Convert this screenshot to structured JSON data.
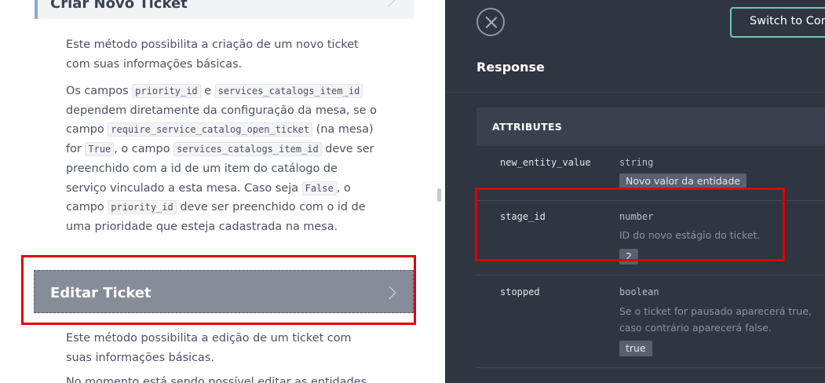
{
  "left": {
    "prev_section": {
      "title": "Criar Novo Ticket"
    },
    "intro_text": "Este método possibilita a criação de um novo ticket com suas informações básicas.",
    "para2": {
      "t1": "Os campos ",
      "c1": "priority_id",
      "t2": " e ",
      "c2": "services_catalogs_item_id",
      "t3": " dependem diretamente da configuração da mesa, se o campo ",
      "c3": "require_service_catalog_open_ticket",
      "t4": " (na mesa) for ",
      "c4": "True",
      "t5": ", o campo ",
      "c5": "services_catalogs_item_id",
      "t6": " deve ser preenchido com a id de um item do catálogo de serviço vinculado a esta mesa. Caso seja ",
      "c6": "False",
      "t7": ", o campo ",
      "c7": "priority_id",
      "t8": " deve ser preenchido com o id de uma prioridade que esteja cadastrada na mesa."
    },
    "edit_section": {
      "title": "Editar Ticket",
      "text": "Este método possibilita a edição de um ticket com suas informações básicas.",
      "next_text": "No momento está sendo possível editar as entidades"
    }
  },
  "right": {
    "switch_button": "Switch to Console",
    "response_title": "Response",
    "attributes_header": "ATTRIBUTES",
    "attributes": [
      {
        "name": "new_entity_value",
        "type": "string",
        "description": "",
        "example": "Novo valor da entidade"
      },
      {
        "name": "stage_id",
        "type": "number",
        "description": "ID do novo estágio do ticket.",
        "example": "2"
      },
      {
        "name": "stopped",
        "type": "boolean",
        "description": "Se o ticket for pausado aparecerá true, caso contrário aparecerá false.",
        "example": "true"
      }
    ]
  }
}
